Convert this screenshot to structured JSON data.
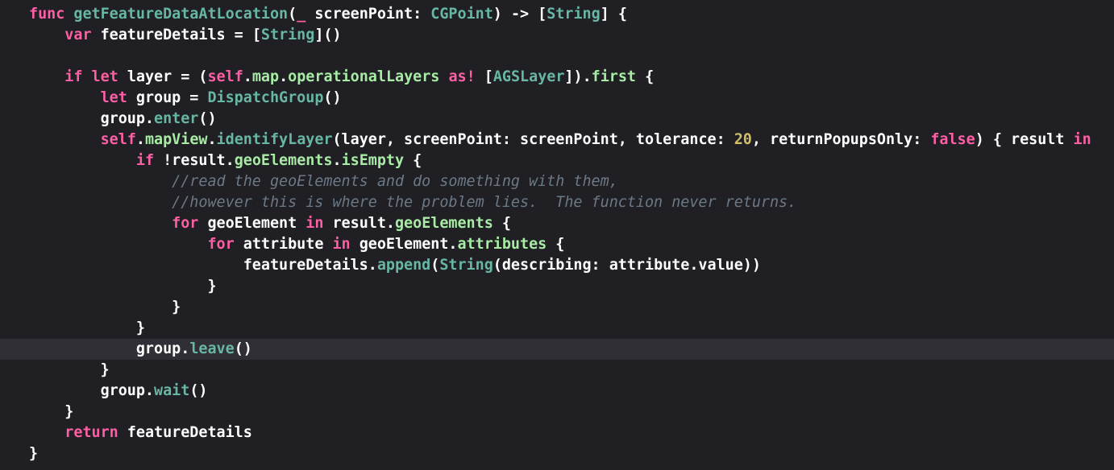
{
  "editor": {
    "language": "Swift",
    "theme": "dark",
    "colors": {
      "background": "#1f1f24",
      "current_line": "#2f2f35",
      "keyword": "#fc5fa3",
      "function": "#67b7a4",
      "type": "#5dd8ff",
      "property": "#a7eba5",
      "number": "#d0bf69",
      "comment": "#6c7986",
      "plain": "#ffffff"
    },
    "current_line_index": 16,
    "lines": [
      [
        [
          "kw",
          "func"
        ],
        [
          "plain",
          " "
        ],
        [
          "fn",
          "getFeatureDataAtLocation"
        ],
        [
          "plain",
          "("
        ],
        [
          "kw",
          "_"
        ],
        [
          "plain",
          " screenPoint: "
        ],
        [
          "typeg",
          "CGPoint"
        ],
        [
          "plain",
          ") -> ["
        ],
        [
          "typeg",
          "String"
        ],
        [
          "plain",
          "] {"
        ]
      ],
      [
        [
          "plain",
          "    "
        ],
        [
          "kw",
          "var"
        ],
        [
          "plain",
          " featureDetails = ["
        ],
        [
          "typeg",
          "String"
        ],
        [
          "plain",
          "]()"
        ]
      ],
      [],
      [
        [
          "plain",
          "    "
        ],
        [
          "kw",
          "if"
        ],
        [
          "plain",
          " "
        ],
        [
          "kw",
          "let"
        ],
        [
          "plain",
          " layer = ("
        ],
        [
          "kw",
          "self"
        ],
        [
          "plain",
          "."
        ],
        [
          "prop",
          "map"
        ],
        [
          "plain",
          "."
        ],
        [
          "prop",
          "operationalLayers"
        ],
        [
          "plain",
          " "
        ],
        [
          "kw",
          "as!"
        ],
        [
          "plain",
          " ["
        ],
        [
          "typeg",
          "AGSLayer"
        ],
        [
          "plain",
          "])."
        ],
        [
          "prop",
          "first"
        ],
        [
          "plain",
          " {"
        ]
      ],
      [
        [
          "plain",
          "        "
        ],
        [
          "kw",
          "let"
        ],
        [
          "plain",
          " group = "
        ],
        [
          "typeg",
          "DispatchGroup"
        ],
        [
          "plain",
          "()"
        ]
      ],
      [
        [
          "plain",
          "        group."
        ],
        [
          "fn",
          "enter"
        ],
        [
          "plain",
          "()"
        ]
      ],
      [
        [
          "plain",
          "        "
        ],
        [
          "kw",
          "self"
        ],
        [
          "plain",
          "."
        ],
        [
          "prop",
          "mapView"
        ],
        [
          "plain",
          "."
        ],
        [
          "fn",
          "identifyLayer"
        ],
        [
          "plain",
          "(layer, screenPoint: screenPoint, tolerance: "
        ],
        [
          "num",
          "20"
        ],
        [
          "plain",
          ", returnPopupsOnly: "
        ],
        [
          "kw",
          "false"
        ],
        [
          "plain",
          ") { result "
        ],
        [
          "kw",
          "in"
        ]
      ],
      [
        [
          "plain",
          "            "
        ],
        [
          "kw",
          "if"
        ],
        [
          "plain",
          " !result."
        ],
        [
          "prop",
          "geoElements"
        ],
        [
          "plain",
          "."
        ],
        [
          "prop",
          "isEmpty"
        ],
        [
          "plain",
          " {"
        ]
      ],
      [
        [
          "plain",
          "                "
        ],
        [
          "cm",
          "//read the geoElements and do something with them,"
        ]
      ],
      [
        [
          "plain",
          "                "
        ],
        [
          "cm",
          "//however this is where the problem lies.  The function never returns."
        ]
      ],
      [
        [
          "plain",
          "                "
        ],
        [
          "kw",
          "for"
        ],
        [
          "plain",
          " geoElement "
        ],
        [
          "kw",
          "in"
        ],
        [
          "plain",
          " result."
        ],
        [
          "prop",
          "geoElements"
        ],
        [
          "plain",
          " {"
        ]
      ],
      [
        [
          "plain",
          "                    "
        ],
        [
          "kw",
          "for"
        ],
        [
          "plain",
          " attribute "
        ],
        [
          "kw",
          "in"
        ],
        [
          "plain",
          " geoElement."
        ],
        [
          "prop",
          "attributes"
        ],
        [
          "plain",
          " {"
        ]
      ],
      [
        [
          "plain",
          "                        featureDetails."
        ],
        [
          "fn",
          "append"
        ],
        [
          "plain",
          "("
        ],
        [
          "typeg",
          "String"
        ],
        [
          "plain",
          "(describing: attribute.value))"
        ]
      ],
      [
        [
          "plain",
          "                    }"
        ]
      ],
      [
        [
          "plain",
          "                }"
        ]
      ],
      [
        [
          "plain",
          "            }"
        ]
      ],
      [
        [
          "plain",
          "            group."
        ],
        [
          "fn",
          "leave"
        ],
        [
          "plain",
          "()"
        ]
      ],
      [
        [
          "plain",
          "        }"
        ]
      ],
      [
        [
          "plain",
          "        group."
        ],
        [
          "fn",
          "wait"
        ],
        [
          "plain",
          "()"
        ]
      ],
      [
        [
          "plain",
          "    }"
        ]
      ],
      [
        [
          "plain",
          "    "
        ],
        [
          "kw",
          "return"
        ],
        [
          "plain",
          " featureDetails"
        ]
      ],
      [
        [
          "plain",
          "}"
        ]
      ]
    ]
  }
}
